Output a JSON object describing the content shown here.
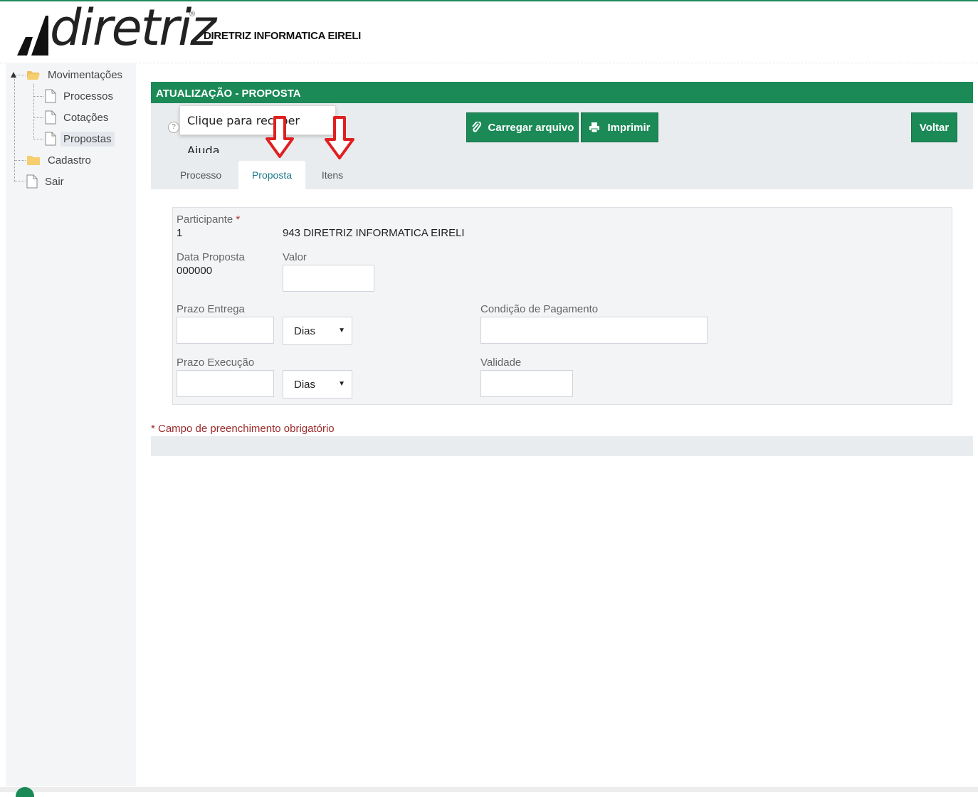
{
  "header": {
    "logo_text": "diretriz",
    "logo_reg": "®",
    "company_name": "DIRETRIZ INFORMATICA EIRELI"
  },
  "sidebar": {
    "items": [
      {
        "label": "Movimentações",
        "icon": "folder-open-icon"
      },
      {
        "label": "Processos",
        "icon": "file-icon"
      },
      {
        "label": "Cotações",
        "icon": "file-icon"
      },
      {
        "label": "Propostas",
        "icon": "file-icon",
        "selected": true
      },
      {
        "label": "Cadastro",
        "icon": "folder-icon"
      },
      {
        "label": "Sair",
        "icon": "file-icon"
      }
    ]
  },
  "panel": {
    "title": "ATUALIZAÇÃO - PROPOSTA",
    "help_icon_text": "?",
    "help_tooltip": "Clique para receber Ajuda",
    "buttons": {
      "upload": "Carregar arquivo",
      "print": "Imprimir",
      "back": "Voltar"
    }
  },
  "tabs": [
    {
      "label": "Processo"
    },
    {
      "label": "Proposta",
      "active": true
    },
    {
      "label": "Itens"
    }
  ],
  "form": {
    "participante_label": "Participante",
    "required_mark": "*",
    "participante_id": "1",
    "participante_name": "943 DIRETRIZ INFORMATICA EIRELI",
    "data_proposta_label": "Data Proposta",
    "data_proposta_value": "000000",
    "valor_label": "Valor",
    "valor_value": "",
    "prazo_entrega_label": "Prazo Entrega",
    "prazo_entrega_value": "",
    "prazo_entrega_unit": "Dias",
    "condicao_label": "Condição de Pagamento",
    "condicao_value": "",
    "prazo_execucao_label": "Prazo Execução",
    "prazo_execucao_value": "",
    "prazo_execucao_unit": "Dias",
    "validade_label": "Validade",
    "validade_value": "",
    "caret": "▼"
  },
  "footer_note": "* Campo de preenchimento obrigatório",
  "colors": {
    "brand_green": "#1b8a57",
    "annotation_red": "#e02020"
  }
}
